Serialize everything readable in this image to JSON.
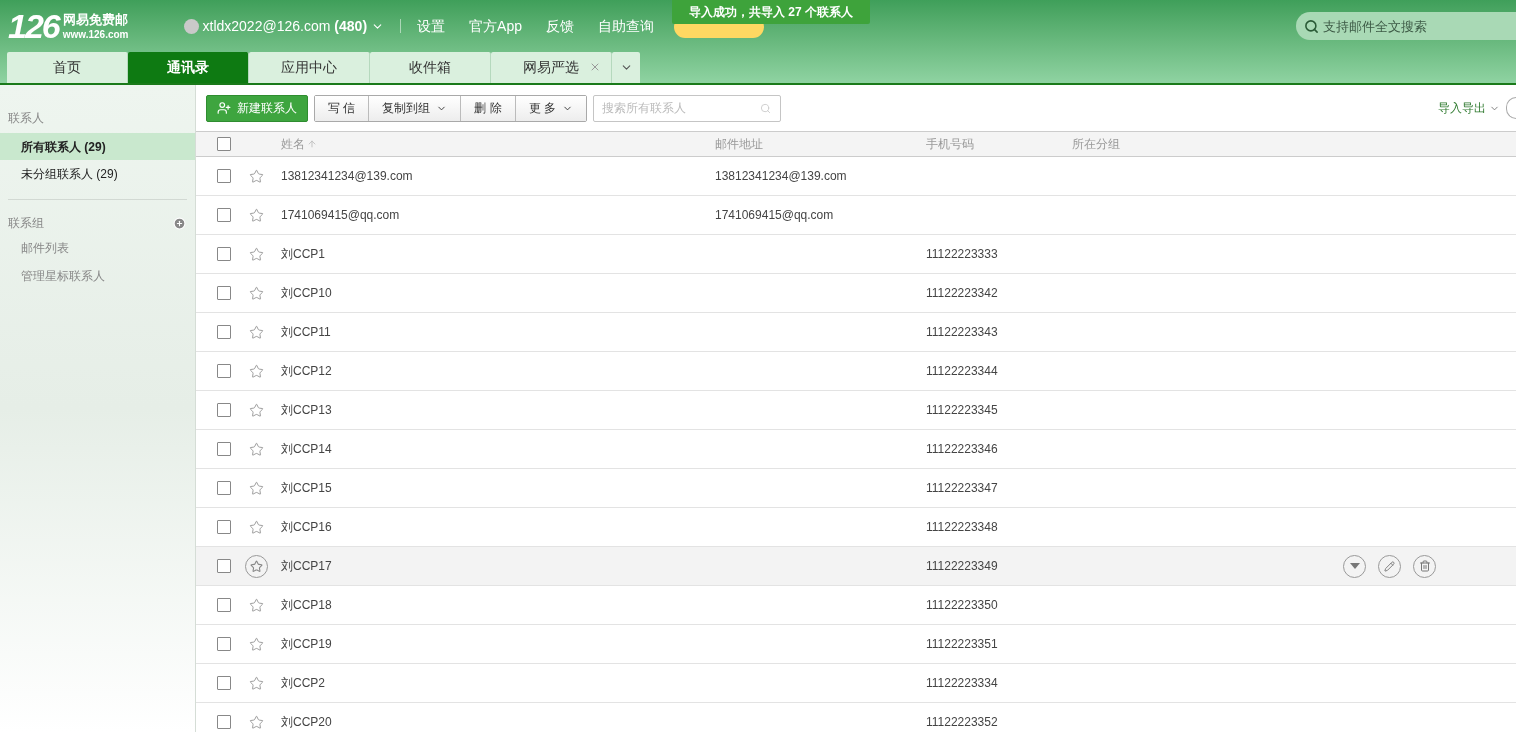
{
  "header": {
    "logo_number": "126",
    "logo_name": "网易免费邮",
    "logo_url": "www.126.com",
    "account": "xtldx2022@126.com",
    "unread": "(480)",
    "links": [
      "设置",
      "官方App",
      "反馈",
      "自助查询"
    ],
    "toast": "导入成功，共导入 27 个联系人",
    "search": {
      "placeholder": "支持邮件全文搜索"
    }
  },
  "tabs": [
    {
      "label": "首页",
      "selected": false,
      "closable": false
    },
    {
      "label": "通讯录",
      "selected": true,
      "closable": false
    },
    {
      "label": "应用中心",
      "selected": false,
      "closable": false
    },
    {
      "label": "收件箱",
      "selected": false,
      "closable": false
    },
    {
      "label": "网易严选",
      "selected": false,
      "closable": true
    }
  ],
  "sidebar": {
    "contacts_heading": "联系人",
    "items": [
      {
        "label": "所有联系人 (29)",
        "selected": true
      },
      {
        "label": "未分组联系人 (29)",
        "selected": false
      }
    ],
    "groups_heading": "联系组",
    "group_items": [
      "邮件列表",
      "管理星标联系人"
    ]
  },
  "toolbar": {
    "new_contact": "新建联系人",
    "buttons": [
      {
        "label": "写 信",
        "dropdown": false
      },
      {
        "label": "复制到组",
        "dropdown": true
      },
      {
        "label": "删 除",
        "dropdown": false
      },
      {
        "label": "更 多",
        "dropdown": true
      }
    ],
    "search": {
      "placeholder": "搜索所有联系人"
    },
    "import_export": "导入导出"
  },
  "table": {
    "columns": [
      "姓名",
      "邮件地址",
      "手机号码",
      "所在分组"
    ],
    "select_all_checked": false,
    "rows": [
      {
        "name": "13812341234@139.com",
        "email": "13812341234@139.com",
        "phone": "",
        "hovered": false,
        "checked": false
      },
      {
        "name": "1741069415@qq.com",
        "email": "1741069415@qq.com",
        "phone": "",
        "hovered": false,
        "checked": false
      },
      {
        "name": "刘CCP1",
        "email": "",
        "phone": "11122223333",
        "hovered": false,
        "checked": false
      },
      {
        "name": "刘CCP10",
        "email": "",
        "phone": "11122223342",
        "hovered": false,
        "checked": false
      },
      {
        "name": "刘CCP11",
        "email": "",
        "phone": "11122223343",
        "hovered": false,
        "checked": false
      },
      {
        "name": "刘CCP12",
        "email": "",
        "phone": "11122223344",
        "hovered": false,
        "checked": false
      },
      {
        "name": "刘CCP13",
        "email": "",
        "phone": "11122223345",
        "hovered": false,
        "checked": false
      },
      {
        "name": "刘CCP14",
        "email": "",
        "phone": "11122223346",
        "hovered": false,
        "checked": false
      },
      {
        "name": "刘CCP15",
        "email": "",
        "phone": "11122223347",
        "hovered": false,
        "checked": false
      },
      {
        "name": "刘CCP16",
        "email": "",
        "phone": "11122223348",
        "hovered": false,
        "checked": false
      },
      {
        "name": "刘CCP17",
        "email": "",
        "phone": "11122223349",
        "hovered": true,
        "checked": false
      },
      {
        "name": "刘CCP18",
        "email": "",
        "phone": "11122223350",
        "hovered": false,
        "checked": false
      },
      {
        "name": "刘CCP19",
        "email": "",
        "phone": "11122223351",
        "hovered": false,
        "checked": false
      },
      {
        "name": "刘CCP2",
        "email": "",
        "phone": "11122223334",
        "hovered": false,
        "checked": false
      },
      {
        "name": "刘CCP20",
        "email": "",
        "phone": "11122223352",
        "hovered": false,
        "checked": false
      }
    ]
  }
}
